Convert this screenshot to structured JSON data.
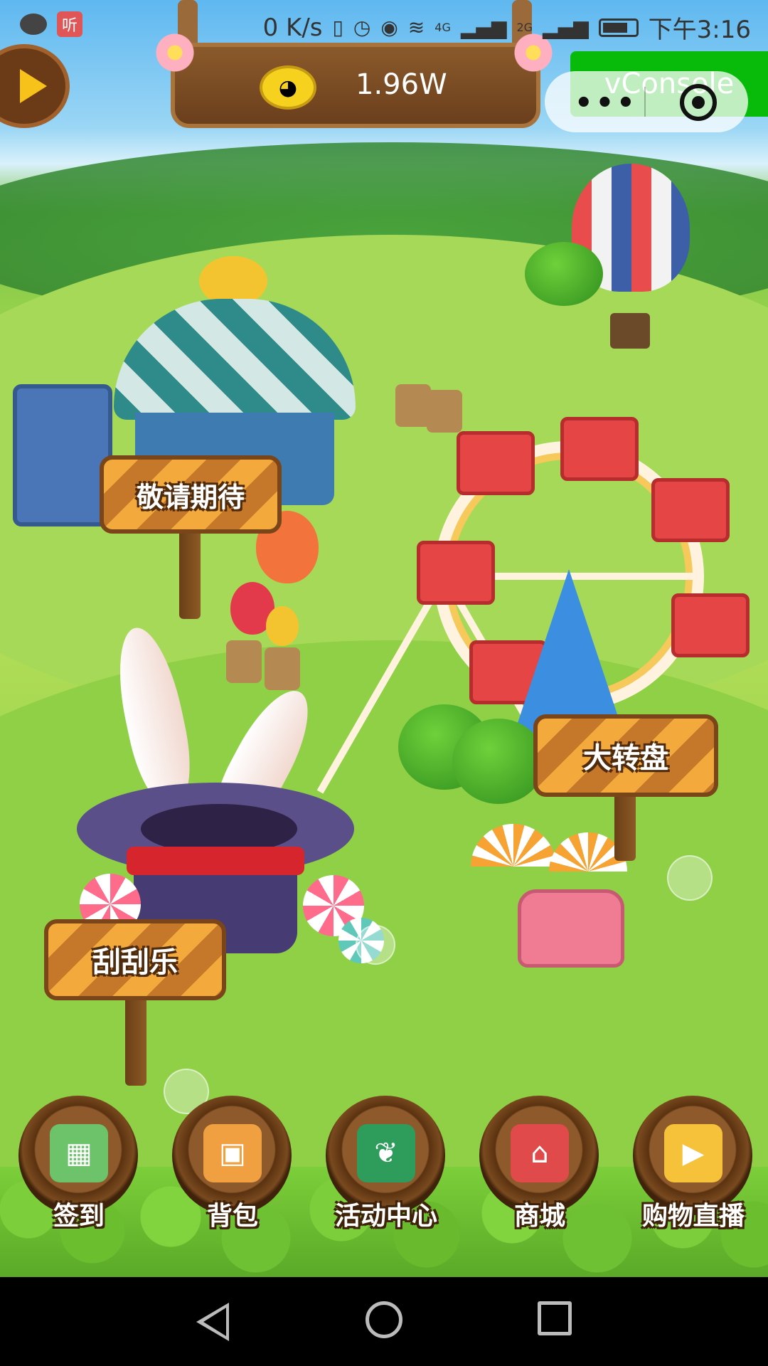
{
  "status_bar": {
    "left_icons": [
      "chat-bubble-icon",
      "listen-app-icon"
    ],
    "listen_badge": "听",
    "network_speed": "0 K/s",
    "network_4g": "4G",
    "network_2g": "2G",
    "time": "下午3:16"
  },
  "header": {
    "coin_amount": "1.96W"
  },
  "vconsole": {
    "label": "vConsole"
  },
  "capsule": {
    "more_label": "•••"
  },
  "signs": {
    "coming_soon": "敬请期待",
    "big_wheel": "大转盘",
    "scratch_card": "刮刮乐"
  },
  "bottom_nav": [
    {
      "label": "签到",
      "icon": "map-icon",
      "color": "#6cc36a"
    },
    {
      "label": "背包",
      "icon": "backpack-icon",
      "color": "#f0a040"
    },
    {
      "label": "活动中心",
      "icon": "book-icon",
      "color": "#2e9c5a"
    },
    {
      "label": "商城",
      "icon": "shop-icon",
      "color": "#e04a4a"
    },
    {
      "label": "购物直播",
      "icon": "tv-icon",
      "color": "#f5c23a"
    }
  ],
  "colors": {
    "vconsole_green": "#08ba0a",
    "sign_orange": "#f3a93b",
    "wood_brown": "#6b3f1d"
  }
}
